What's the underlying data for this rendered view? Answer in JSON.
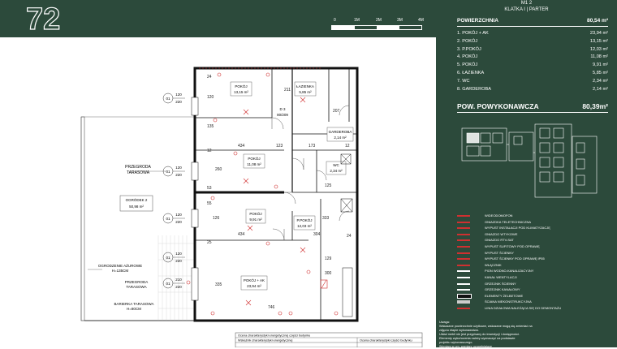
{
  "logo": {
    "text": "72"
  },
  "scale": {
    "labels": [
      "0",
      "1M",
      "2M",
      "3M",
      "4M"
    ]
  },
  "panel": {
    "unit_line": "M1 2",
    "location_line": "KLATKA I | PARTER",
    "area_label": "POWIERZCHNIA",
    "area_total": "80,54 m²",
    "rooms": [
      {
        "name": "1. POKÓJ + AK",
        "area": "23,94 m²"
      },
      {
        "name": "2. POKÓJ",
        "area": "13,15 m²"
      },
      {
        "name": "3. P.POKÓJ",
        "area": "12,03 m²"
      },
      {
        "name": "4. POKÓJ",
        "area": "11,08 m²"
      },
      {
        "name": "5. POKÓJ",
        "area": "9,91 m²"
      },
      {
        "name": "6. ŁAZIENKA",
        "area": "5,85 m²"
      },
      {
        "name": "7. WC",
        "area": "2,34 m²"
      },
      {
        "name": "8. GARDEROBA",
        "area": "2,14 m²"
      }
    ],
    "usable_label": "POW. POWYKONAWCZA",
    "usable_value": "80,39m²",
    "legend": [
      {
        "label": "WIDEODOMOFON",
        "color": "#d03030"
      },
      {
        "label": "GNIAZDKA TELETECHNICZNA",
        "color": "#d03030"
      },
      {
        "label": "WYPUST INSTALACJI POD KLIMATYZACJĘ",
        "color": "#d03030"
      },
      {
        "label": "GNIAZDO WTYKOWE",
        "color": "#d03030"
      },
      {
        "label": "GNIAZDO RTV-SAT",
        "color": "#d03030"
      },
      {
        "label": "WYPUST SUFITOWY POD OPRAWĘ",
        "color": "#d03030"
      },
      {
        "label": "WYPUST ŚCIENNY",
        "color": "#d03030"
      },
      {
        "label": "WYPUST ŚCIENNY POD OPRAWĘ IP55",
        "color": "#d03030"
      },
      {
        "label": "WŁĄCZNIK",
        "color": "#d03030"
      },
      {
        "label": "PION WODNO-KANALIZACYJNY",
        "color": "#ffffff"
      },
      {
        "label": "KANAŁ WENTYLACJI",
        "color": "#ffffff"
      },
      {
        "label": "GRZEJNIK ŚCIENNY",
        "color": "#ffffff"
      },
      {
        "label": "GRZEJNIK KANAŁOWY",
        "color": "#ffffff"
      },
      {
        "label": "ELEMENTY ŻELBETOWE",
        "color": "#111111"
      },
      {
        "label": "ŚCIANA NIEKONSTRUKCYJNA",
        "color": "#cccccc"
      },
      {
        "label": "LINIA DZIAŁOWA NALEŻĄCA SIĘ DO DEMONTAŻU",
        "color": "#d03030"
      }
    ],
    "notes": [
      "Uwaga:",
      "Wskazane powierzchnie użytkowe, wskazane mogą się zmieniać na",
      "zdjęciu etapie wykonawstwa.",
      "Układ mebli nie jest przypisany do inwestycji i dostępności.",
      "Elementy wykończenia należy wyznaczyć na podstawie",
      "projektu wykonawczego.",
      "Wymiary w cm, wymiary uzupełniające"
    ]
  },
  "plan": {
    "rooms": [
      {
        "name": "POKÓJ",
        "area": "13,15 m²"
      },
      {
        "name": "ŁAZIENKA",
        "area": "5,85 m²"
      },
      {
        "name": "GARDEROBA",
        "area": "2,14 m²"
      },
      {
        "name": "POKÓJ",
        "area": "11,08 m²"
      },
      {
        "name": "WC",
        "area": "2,34 m²"
      },
      {
        "name": "POKÓJ",
        "area": "9,91 m²"
      },
      {
        "name": "P.POKÓJ",
        "area": "12,03 m²"
      },
      {
        "name": "POKÓJ + AK",
        "area": "23,94 m²"
      }
    ],
    "garden": {
      "name": "OGRÓDEK 2",
      "area": "50,98 m²"
    },
    "labels": {
      "przegroda_top": "PRZEGRODA",
      "tarasowa_top": "TARASOWA",
      "ogrodzenie": "OGRODZENIE AŻUROWE",
      "ogrodzenie_h": "H=135CM",
      "przegroda_bot": "PRZEGRODA",
      "tarasowa_bot": "TARASOWA",
      "barierka": "BARIERKA TARASOWA",
      "barierka_h": "H=80CM"
    },
    "windows": [
      {
        "num": "01",
        "w": "120",
        "h": "220"
      },
      {
        "num": "01",
        "w": "120",
        "h": "220"
      },
      {
        "num": "01",
        "w": "120",
        "h": "220"
      },
      {
        "num": "01",
        "w": "120",
        "h": "220"
      },
      {
        "num": "01",
        "w": "210",
        "h": "220"
      }
    ],
    "dims": {
      "d24a": "24",
      "d120": "120",
      "d135": "135",
      "d434": "434",
      "d12a": "12",
      "d260": "260",
      "d53": "53",
      "d55": "55",
      "d126": "126",
      "d25": "25",
      "d211": "211",
      "d173": "173",
      "d123": "123",
      "d304": "304",
      "d333": "333",
      "d434b": "434",
      "d746": "746",
      "d335": "335",
      "d300": "300",
      "d129": "129",
      "d125": "125",
      "d207": "207",
      "d12b": "12",
      "d24b": "24"
    },
    "door": {
      "top": "D 3",
      "size": "80/209"
    },
    "caption_rows": [
      "Ocena charakterystyki energetycznej części budynku",
      "Wskaźnik charakterystyki energetycznej",
      "Ocena charakterystyki części budynku"
    ]
  }
}
